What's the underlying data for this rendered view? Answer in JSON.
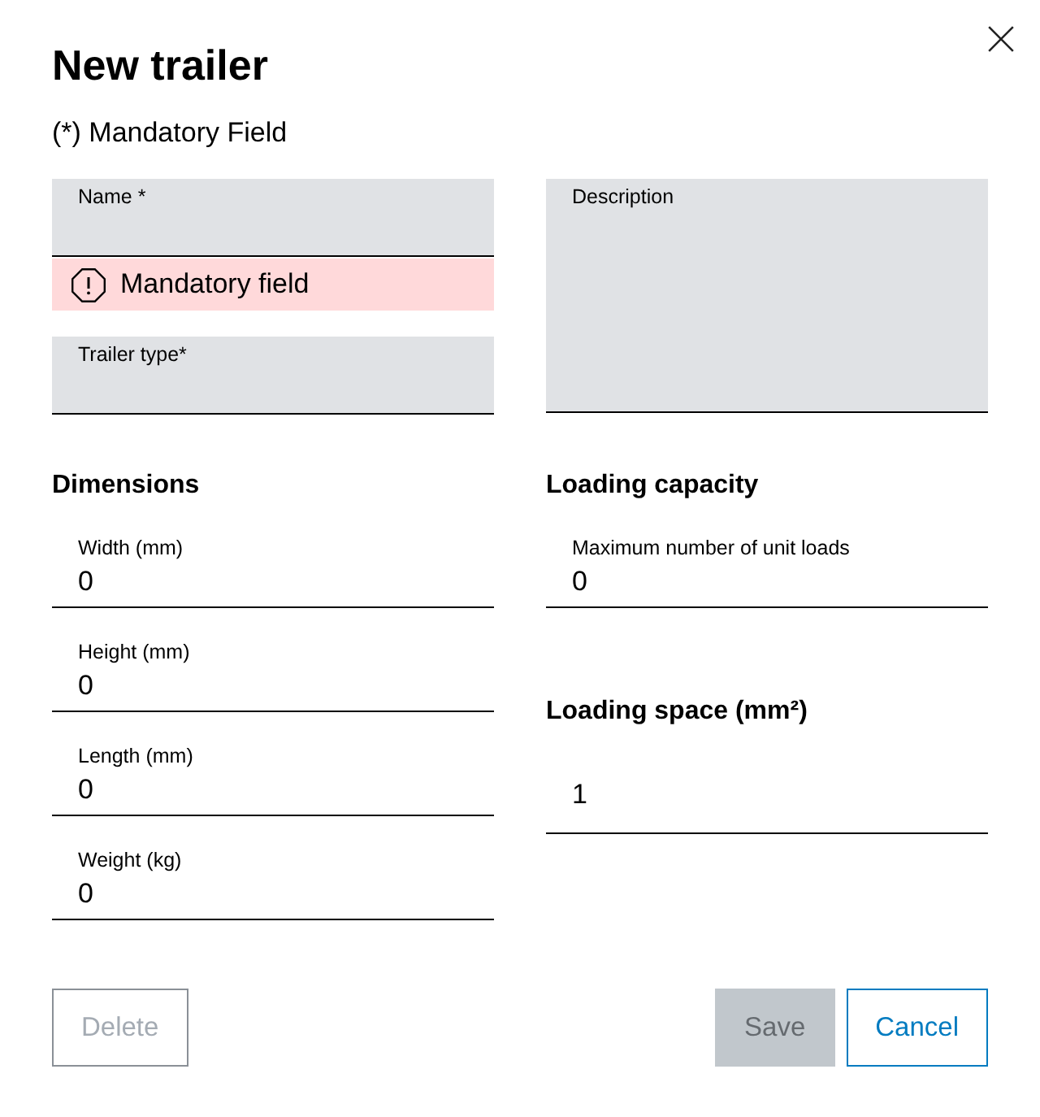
{
  "dialog": {
    "title": "New trailer"
  },
  "mandatory_note": "(*) Mandatory Field",
  "general_fields": [
    {
      "kind": "filled",
      "label": "Name *",
      "error": "Mandatory field"
    },
    {
      "kind": "filled",
      "label": "Trailer type*"
    },
    {
      "kind": "textarea",
      "label": "Description"
    }
  ],
  "sections": [
    {
      "heading": "Dimensions",
      "fields": [
        {
          "label": "Width (mm)",
          "value": "0"
        },
        {
          "label": "Height (mm)",
          "value": "0"
        },
        {
          "label": "Length (mm)",
          "value": "0"
        },
        {
          "label": "Weight (kg)",
          "value": "0"
        }
      ]
    },
    {
      "heading": "Loading capacity",
      "fields": [
        {
          "label": "Maximum number of unit loads",
          "value": "0"
        }
      ]
    },
    {
      "heading": "Loading space (mm²)",
      "fields": [
        {
          "value": "1"
        }
      ]
    }
  ],
  "buttons": [
    {
      "label": "Delete",
      "kind": "secondary",
      "disabled": true
    },
    {
      "label": "Save",
      "kind": "primary",
      "disabled": true
    },
    {
      "label": "Cancel",
      "kind": "secondary",
      "disabled": false
    }
  ]
}
